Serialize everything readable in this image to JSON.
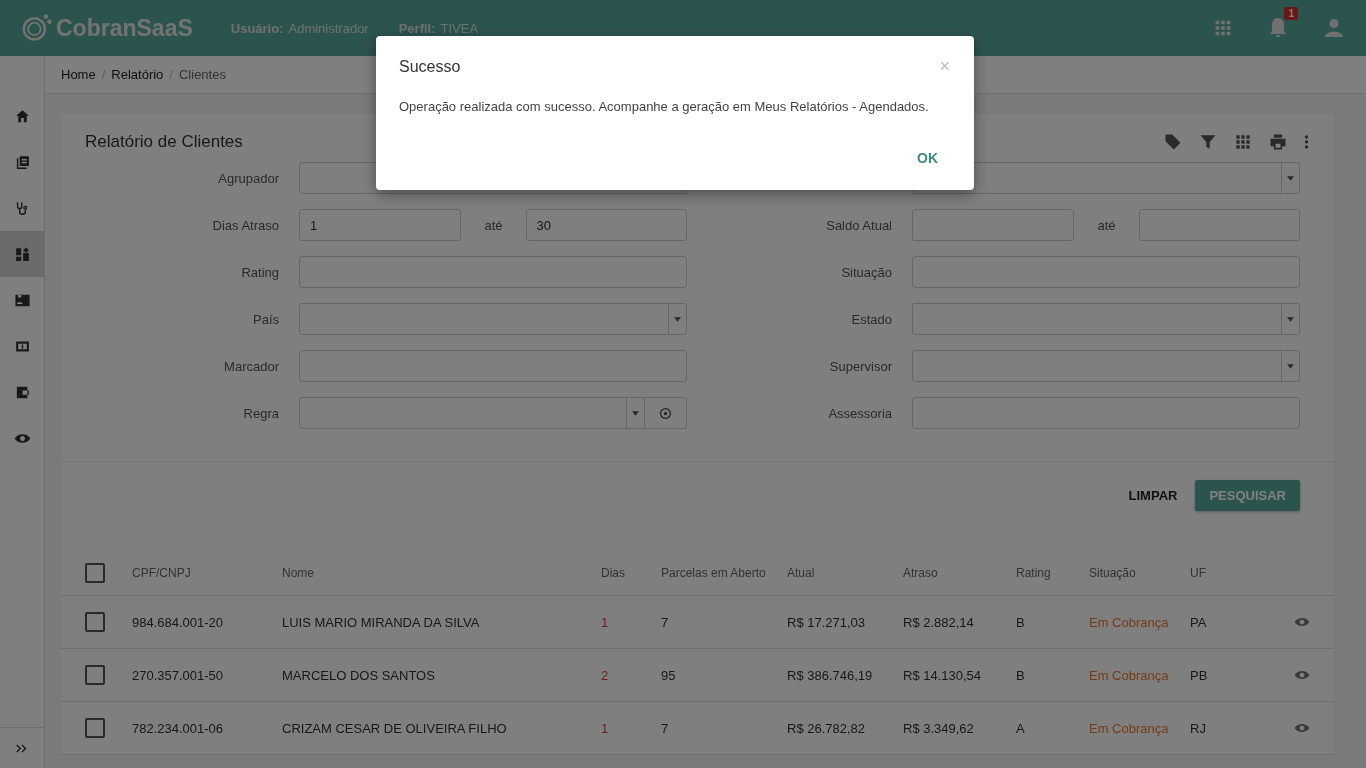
{
  "header": {
    "app_name": "CobranSaaS",
    "user_label": "Usuário:",
    "user": "Administrador",
    "profile_label": "Perfil:",
    "profile": "TIVEA",
    "notification_count": "1"
  },
  "sidebar": {
    "items": [
      {
        "kind": "home",
        "selected": false
      },
      {
        "kind": "library",
        "selected": false
      },
      {
        "kind": "stethoscope",
        "selected": false
      },
      {
        "kind": "dashboard",
        "selected": true
      },
      {
        "kind": "contact",
        "selected": false
      },
      {
        "kind": "money",
        "selected": false
      },
      {
        "kind": "wallet",
        "selected": false
      },
      {
        "kind": "eye",
        "selected": false
      }
    ]
  },
  "breadcrumb": {
    "separator": "/",
    "items": [
      "Home",
      "Relatório",
      "Clientes"
    ]
  },
  "card": {
    "title": "Relatório de Clientes",
    "toolbar": [
      {
        "kind": "tag"
      },
      {
        "kind": "filter"
      },
      {
        "kind": "grid"
      },
      {
        "kind": "print"
      },
      {
        "kind": "more"
      }
    ],
    "form": [
      {
        "label": "Agrupador",
        "kind": "text"
      },
      {
        "kind": "select"
      },
      {
        "label": "Dias Atraso",
        "kind": "range",
        "from": "1",
        "separator": "até",
        "to": "30"
      },
      {
        "label": "Saldo Atual",
        "kind": "range",
        "separator": "até"
      },
      {
        "label": "Rating",
        "kind": "text"
      },
      {
        "label": "Situação",
        "kind": "text"
      },
      {
        "label": "País",
        "kind": "select"
      },
      {
        "label": "Estado",
        "kind": "select"
      },
      {
        "label": "Marcador",
        "kind": "text"
      },
      {
        "label": "Supervisor",
        "kind": "select"
      },
      {
        "label": "Regra",
        "kind": "select_action"
      },
      {
        "label": "Assessoria",
        "kind": "text"
      }
    ],
    "buttons": {
      "clear": "LIMPAR",
      "search": "PESQUISAR"
    }
  },
  "table": {
    "columns": [
      "CPF/CNPJ",
      "Nome",
      "Dias",
      "Parcelas em Aberto",
      "Atual",
      "Atraso",
      "Rating",
      "Situação",
      "UF"
    ],
    "header_checked": false,
    "rows": [
      {
        "checked": false,
        "cells": [
          "984.684.001-20",
          "LUIS MARIO MIRANDA DA SILVA",
          "1",
          "7",
          "R$ 17.271,03",
          "R$ 2.882,14",
          "B",
          "Em Cobrança",
          "PA"
        ]
      },
      {
        "checked": false,
        "cells": [
          "270.357.001-50",
          "MARCELO DOS SANTOS",
          "2",
          "95",
          "R$ 386.746,19",
          "R$ 14.130,54",
          "B",
          "Em Cobrança",
          "PB"
        ]
      },
      {
        "checked": false,
        "cells": [
          "782.234.001-06",
          "CRIZAM CESAR DE OLIVEIRA FILHO",
          "1",
          "7",
          "R$ 26.782,82",
          "R$ 3.349,62",
          "A",
          "Em Cobrança",
          "RJ"
        ]
      }
    ]
  },
  "dialog": {
    "title": "Sucesso",
    "close": "×",
    "message": "Operação realizada com sucesso. Acompanhe a geração em Meus Relatórios - Agendados.",
    "ok": "OK"
  }
}
